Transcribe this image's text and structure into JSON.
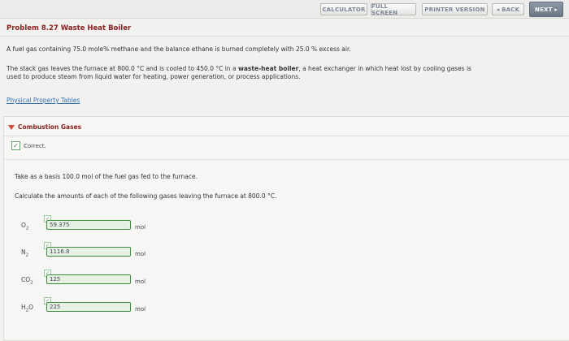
{
  "nav": {
    "calculator": "CALCULATOR",
    "full_screen": "FULL SCREEN",
    "printer_version": "PRINTER VERSION",
    "back": "◂ BACK",
    "next": "NEXT ▸"
  },
  "problem": {
    "title": "Problem 8.27 Waste Heat Boiler",
    "line1": "A fuel gas containing 75.0 mole% methane and the balance ethane is burned completely with 25.0 % excess air.",
    "line2a": "The stack gas leaves the furnace at 800.0 °C and is cooled to 450.0 °C in a ",
    "line2b": "waste-heat boiler",
    "line2c": ", a heat exchanger in which heat lost by cooling gases is",
    "line3": "used to produce steam from liquid water for heating, power generation, or process applications.",
    "link": "Physical Property Tables"
  },
  "section": {
    "title": "Combustion Gases",
    "status": "Correct.",
    "basis": "Take as a basis 100.0 mol of the fuel gas fed to the furnace.",
    "prompt": "Calculate the amounts of each of the following gases leaving the furnace at 800.0 °C."
  },
  "answers": [
    {
      "base": "O",
      "sub": "2",
      "value": "59.375",
      "unit": "mol"
    },
    {
      "base": "N",
      "sub": "2",
      "value": "1116.8",
      "unit": "mol"
    },
    {
      "base": "CO",
      "sub": "2",
      "value": "125",
      "unit": "mol"
    },
    {
      "base": "H",
      "sub": "2",
      "suffix": "O",
      "value": "225",
      "unit": "mol"
    }
  ],
  "colors": {
    "title_red": "#8a2020",
    "link_blue": "#3a6fb0",
    "correct_green": "#3e8a3e"
  }
}
